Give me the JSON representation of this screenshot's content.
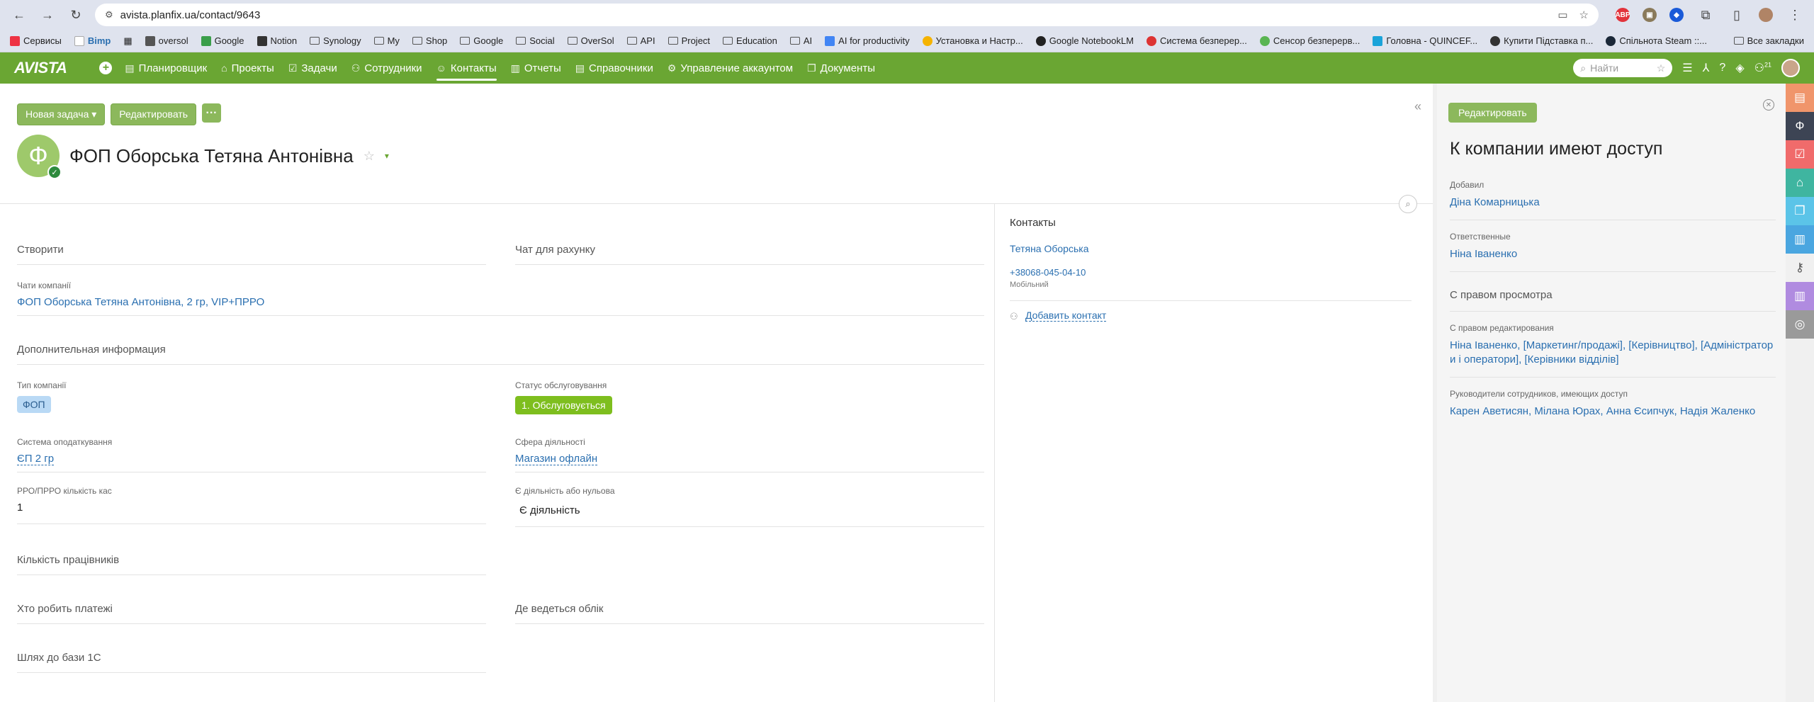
{
  "browser": {
    "url": "avista.planfix.ua/contact/9643",
    "bookmarks": [
      "Сервисы",
      "Bimp",
      "oversol",
      "Google",
      "Notion",
      "Synology",
      "My",
      "Shop",
      "Google",
      "Social",
      "OverSol",
      "API",
      "Project",
      "Education",
      "AI",
      "AI for productivity",
      "Установка и Настр...",
      "Google NotebookLM",
      "Система безперер...",
      "Сенсор безперерв...",
      "Головна - QUINCEF...",
      "Купити Підставка п...",
      "Спільнота Steam ::..."
    ],
    "all_bookmarks": "Все закладки"
  },
  "app": {
    "logo": "AVISTA",
    "menu": [
      {
        "label": "Планировщик",
        "icon": "▤"
      },
      {
        "label": "Проекты",
        "icon": "⌂"
      },
      {
        "label": "Задачи",
        "icon": "☑"
      },
      {
        "label": "Сотрудники",
        "icon": "⚇"
      },
      {
        "label": "Контакты",
        "icon": "☺"
      },
      {
        "label": "Отчеты",
        "icon": "▥"
      },
      {
        "label": "Справочники",
        "icon": "▤"
      },
      {
        "label": "Управление аккаунтом",
        "icon": "⚙"
      },
      {
        "label": "Документы",
        "icon": "❐"
      }
    ],
    "search_placeholder": "Найти",
    "notif_count": "21"
  },
  "toolbar": {
    "new_task": "Новая задача ▾",
    "edit": "Редактировать",
    "more": "···"
  },
  "contact": {
    "avatar_letter": "Ф",
    "title": "ФОП Оборська Тетяна Антонівна"
  },
  "fields": {
    "stvoryty": "Створити",
    "chat_rahunok": "Чат для рахунку",
    "chats_label": "Чати компанії",
    "chats_value": "ФОП Оборська Тетяна Антонівна, 2 гр, VIP+ПРРО",
    "additional": "Дополнительная информация",
    "type_label": "Тип компанії",
    "type_value": "ФОП",
    "status_label": "Статус обслуговування",
    "status_value": "1. Обслуговується",
    "tax_label": "Система оподаткування",
    "tax_value": "ЄП 2 гр",
    "sphere_label": "Сфера діяльності",
    "sphere_value": "Магазин офлайн",
    "rro_label": "РРО/ПРРО кількість кас",
    "rro_value": "1",
    "activity_label": "Є діяльність або нульова",
    "activity_value": "Є діяльність",
    "employees": "Кількість працівників",
    "payer": "Хто робить платежі",
    "accounting": "Де ведеться облік",
    "path1c": "Шлях до бази 1С"
  },
  "contacts": {
    "title": "Контакты",
    "name": "Тетяна Оборська",
    "phone": "+38068-045-04-10",
    "phone_label": "Мобільний",
    "add": "Добавить контакт"
  },
  "panel": {
    "edit": "Редактировать",
    "title": "К компании имеют доступ",
    "added_label": "Добавил",
    "added_value": "Діна Комарницька",
    "resp_label": "Ответственные",
    "resp_value": "Ніна Іваненко",
    "view_rights": "С правом просмотра",
    "edit_rights_label": "С правом редактирования",
    "edit_rights_value": "Ніна Іваненко, [Маркетинг/продажі], [Керівництво], [Адміністратор и і оператори], [Керівники відділів]",
    "heads_label": "Руководители сотрудников, имеющих доступ",
    "heads_value": "Карен Аветисян, Мілана Юрах, Анна Єсипчук, Надія Жаленко"
  },
  "rail_colors": [
    "#f0956b",
    "#3d4454",
    "#f06b6b",
    "#3fb5a0",
    "#5bc4e8",
    "#4aa6e0",
    "#f0f0f0",
    "#b08be0",
    "#9a9a9a"
  ]
}
